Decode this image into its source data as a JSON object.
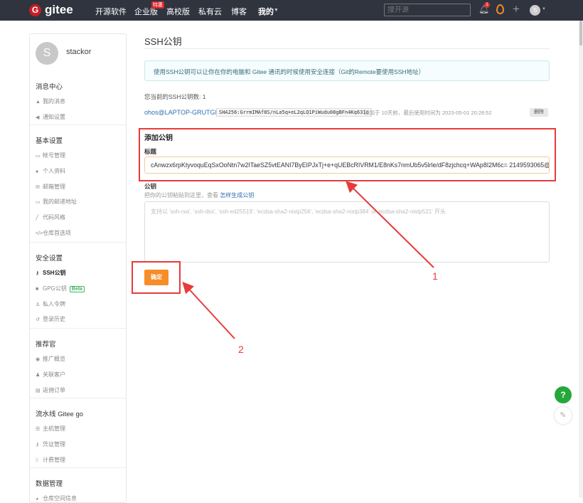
{
  "nav": {
    "logo_letter": "G",
    "brand": "gitee",
    "links": [
      "开源软件",
      "企业版",
      "高校版",
      "私有云",
      "博客",
      "我的"
    ],
    "hot_badge": "特惠",
    "search_placeholder": "搜开源",
    "notif_count": "1",
    "avatar_letter": "S"
  },
  "sidebar": {
    "avatar_letter": "S",
    "username": "stackor",
    "sections": [
      {
        "title": "消息中心",
        "items": [
          {
            "icon": "bell-icon",
            "label": "我的消息"
          },
          {
            "icon": "volume-icon",
            "label": "通知设置"
          }
        ]
      },
      {
        "title": "基本设置",
        "items": [
          {
            "icon": "id-card-icon",
            "label": "帐号管理"
          },
          {
            "icon": "user-icon",
            "label": "个人资料"
          },
          {
            "icon": "mail-icon",
            "label": "邮箱管理"
          },
          {
            "icon": "address-card-icon",
            "label": "我的邮递地址"
          },
          {
            "icon": "brush-icon",
            "label": "代码风格"
          },
          {
            "icon": "code-icon",
            "label": "仓库首选项"
          }
        ]
      },
      {
        "title": "安全设置",
        "items": [
          {
            "icon": "key-icon",
            "label": "SSH公钥",
            "active": true
          },
          {
            "icon": "lock-icon",
            "label": "GPG公钥",
            "badge": "Beta"
          },
          {
            "icon": "token-icon",
            "label": "私人令牌"
          },
          {
            "icon": "history-icon",
            "label": "登录历史"
          }
        ]
      },
      {
        "title": "推荐官",
        "items": [
          {
            "icon": "dashboard-icon",
            "label": "推广概览"
          },
          {
            "icon": "users-icon",
            "label": "关联客户"
          },
          {
            "icon": "order-icon",
            "label": "返佣订单"
          }
        ]
      },
      {
        "title": "流水线 Gitee go",
        "items": [
          {
            "icon": "server-icon",
            "label": "主机管理"
          },
          {
            "icon": "key-icon",
            "label": "凭证管理"
          },
          {
            "icon": "plan-icon",
            "label": "计费管理"
          }
        ]
      },
      {
        "title": "数据管理",
        "items": [
          {
            "icon": "pie-icon",
            "label": "仓库空间信息"
          }
        ]
      }
    ]
  },
  "main": {
    "title": "SSH公钥",
    "info": "使用SSH公钥可以让你在你的电脑和 Gitee 通讯的时候使用安全连接（Git的Remote要使用SSH地址）",
    "count_label": "您当前的SSH公钥数: 1",
    "key": {
      "name": "ohos@LAPTOP-GRUTGI...",
      "fingerprint": "SHA256:GrrmIMAf8S/nLa5q+eL2qLQ1PiWudu08gBFn4Kq631o",
      "meta": "添加于 10天前，最后使用时间为 2023-05-01 20:28:52",
      "delete": "删除"
    },
    "add_title": "添加公钥",
    "title_label": "标题",
    "title_value": "cAnwzx6rpKtyvoquEqSxOoNtn7w2ITaeSZ5vtEANI7ByEIPJxTj+e+qUEBcRIVRM1/E8nKs7nmUb5v5lrle/dF8zjchcq+WAp8I2M6c= 2149593065@qq.com",
    "key_label": "公钥",
    "hint": "把你的公钥粘贴到这里，查看 ",
    "hint_link": "怎样生成公钥",
    "key_placeholder": "支持以 'ssh-rsa', 'ssh-dss', 'ssh-ed25519', 'ecdsa-sha2-nistp256', 'ecdsa-sha2-nistp384' or 'ecdsa-sha2-nistp521' 开头",
    "submit": "确定"
  },
  "annotations": {
    "label1": "1",
    "label2": "2",
    "color": "#e83a3a"
  },
  "float": {
    "help": "?"
  }
}
